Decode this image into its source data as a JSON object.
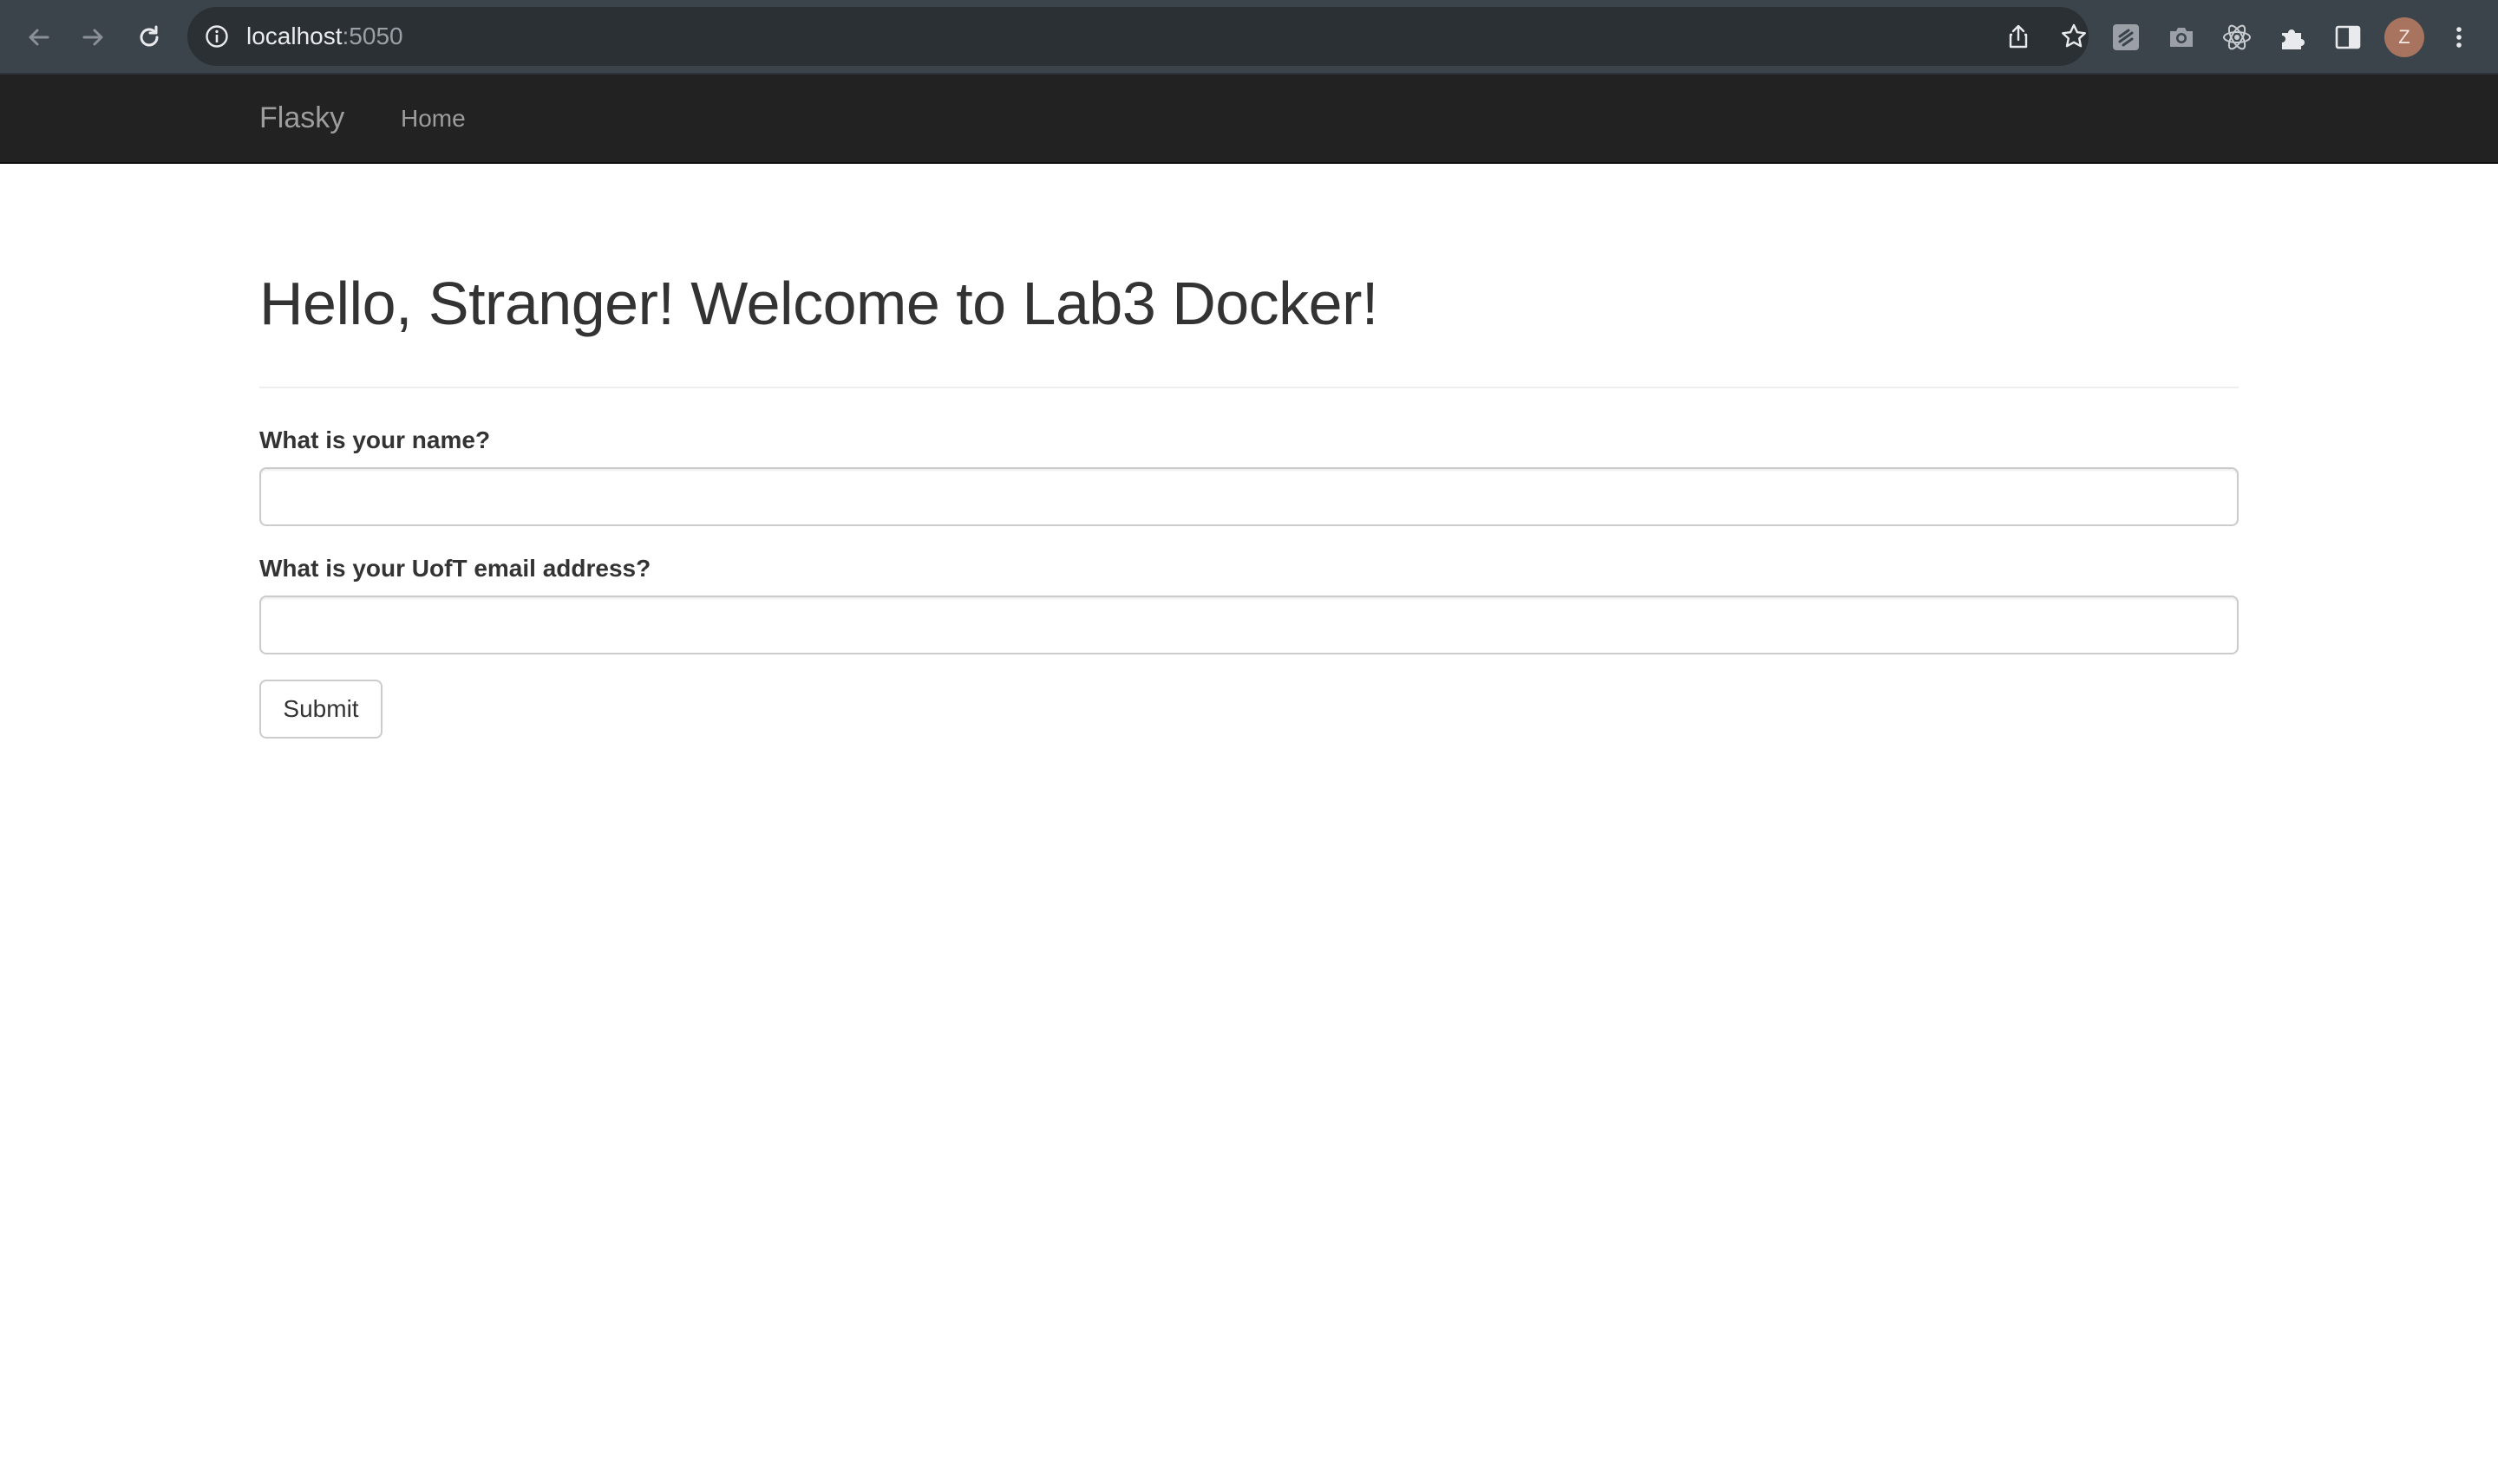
{
  "browser": {
    "url_host": "localhost",
    "url_port": ":5050",
    "profile_initial": "Z"
  },
  "navbar": {
    "brand": "Flasky",
    "links": [
      {
        "label": "Home"
      }
    ]
  },
  "main": {
    "title": "Hello, Stranger! Welcome to Lab3 Docker!",
    "form": {
      "name_label": "What is your name?",
      "name_value": "",
      "email_label": "What is your UofT email address?",
      "email_value": "",
      "submit_label": "Submit"
    }
  },
  "colors": {
    "navbar_bg": "#222222",
    "navbar_text": "#9d9d9d",
    "toolbar_bg": "#3b444b",
    "heading_text": "#333333"
  },
  "icons": {
    "back": "back-arrow-icon",
    "forward": "forward-arrow-icon",
    "reload": "reload-icon",
    "site_info": "info-icon",
    "share": "share-icon",
    "bookmark": "star-icon",
    "extensions": [
      "extension-doc-icon",
      "camera-icon",
      "react-icon",
      "puzzle-icon"
    ],
    "side_panel": "side-panel-icon",
    "menu": "kebab-menu-icon"
  }
}
